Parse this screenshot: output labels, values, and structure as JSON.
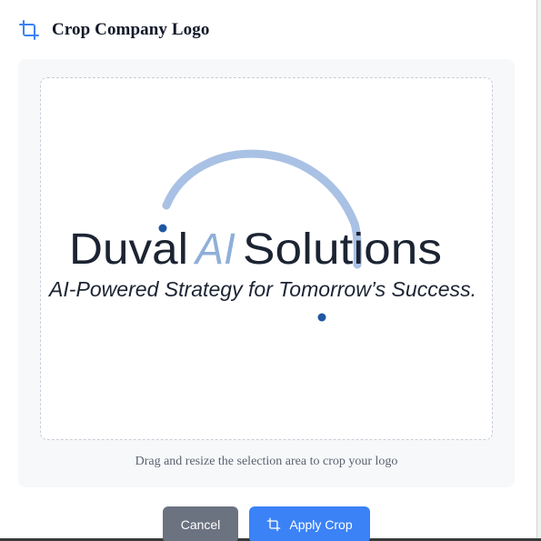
{
  "dialog": {
    "title": "Crop Company Logo",
    "title_icon": "crop-icon",
    "hint": "Drag and resize the selection area to crop your logo"
  },
  "logo": {
    "word_duval": "Duval",
    "word_ai": "AI",
    "word_solutions": "Solutions",
    "tagline": "AI-Powered Strategy for Tomorrow’s Success.",
    "colors": {
      "text": "#1c2433",
      "ai": "#8fafd9",
      "arc": "#a9c1e4",
      "dot": "#1f57a3"
    }
  },
  "buttons": {
    "cancel": "Cancel",
    "apply": "Apply Crop",
    "apply_icon": "crop-icon"
  },
  "colors": {
    "accent": "#3b82f6",
    "cancel": "#6b7280",
    "title": "#111827"
  }
}
